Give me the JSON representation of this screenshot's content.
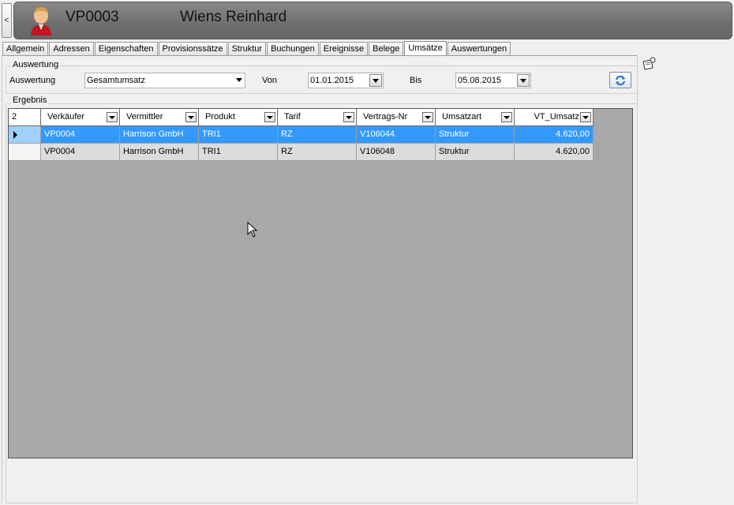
{
  "header": {
    "collapse_label": "<",
    "id": "VP0003",
    "name": "Wiens Reinhard"
  },
  "tabs": [
    {
      "label": "Allgemein"
    },
    {
      "label": "Adressen"
    },
    {
      "label": "Eigenschaften"
    },
    {
      "label": "Provisionssätze"
    },
    {
      "label": "Struktur"
    },
    {
      "label": "Buchungen"
    },
    {
      "label": "Ereignisse"
    },
    {
      "label": "Belege"
    },
    {
      "label": "Umsätze",
      "active": true
    },
    {
      "label": "Auswertungen"
    }
  ],
  "auswertung": {
    "group_title": "Auswertung",
    "label": "Auswertung",
    "selected": "Gesamtumsatz",
    "von_label": "Von",
    "von_value": "01.01.2015",
    "bis_label": "Bis",
    "bis_value": "05.08.2015"
  },
  "ergebnis": {
    "group_title": "Ergebnis",
    "row_count": "2",
    "columns": [
      "Verkäufer",
      "Vermittler",
      "Produkt",
      "Tarif",
      "Vertrags-Nr",
      "Umsatzart",
      "VT_Umsatz"
    ],
    "rows": [
      [
        "VP0004",
        "Harrison GmbH",
        "TRI1",
        "RZ",
        "V106044",
        "Struktur",
        "4.620,00"
      ],
      [
        "VP0004",
        "Harrison GmbH",
        "TRI1",
        "RZ",
        "V106048",
        "Struktur",
        "4.620,00"
      ]
    ]
  },
  "colors": {
    "selected_row": "#3399ff",
    "grid_background": "#a8a8a8",
    "header_bar": "#767676"
  }
}
